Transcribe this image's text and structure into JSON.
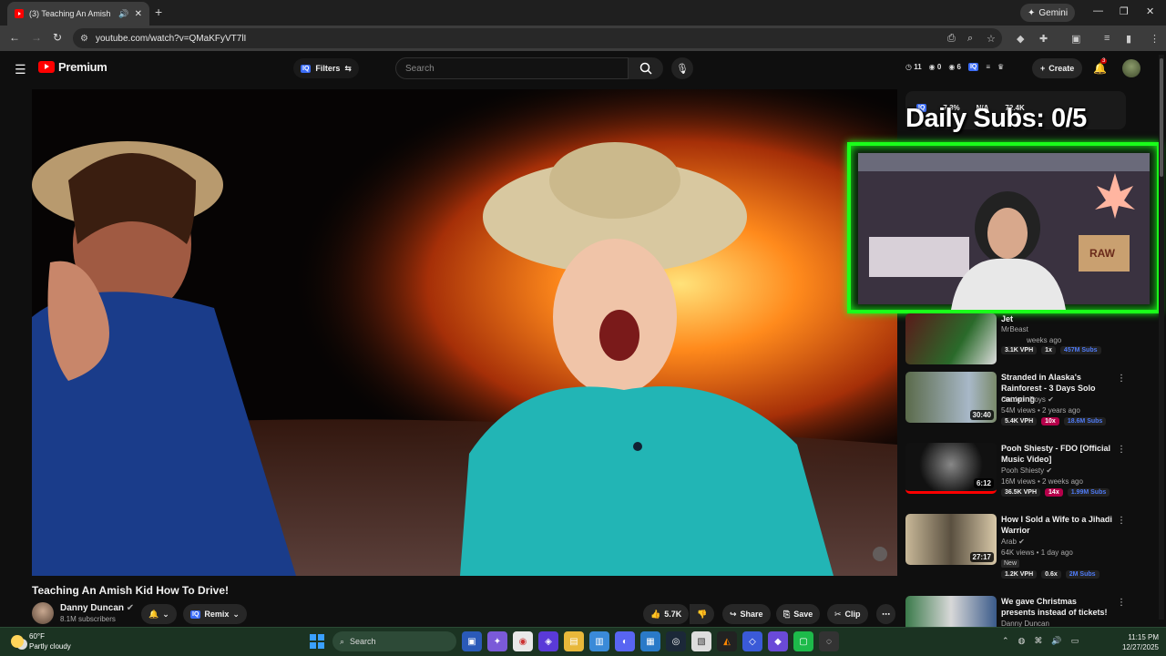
{
  "browser": {
    "tab_title": "(3) Teaching An Amish Kid",
    "url": "youtube.com/watch?v=QMaKFyVT7lI",
    "gemini_label": "Gemini",
    "new_tab": "+"
  },
  "youtube": {
    "logo_text": "Premium",
    "filters_label": "Filters",
    "search_placeholder": "Search",
    "header_stats": {
      "a": "11",
      "b": "0",
      "c": "6"
    },
    "create_label": "Create",
    "notification_count": "3"
  },
  "video": {
    "title": "Teaching An Amish Kid How To Drive!",
    "channel": "Danny Duncan",
    "subscribers": "8.1M subscribers",
    "remix_label": "Remix",
    "likes": "5.7K",
    "share_label": "Share",
    "save_label": "Save",
    "clip_label": "Clip"
  },
  "overlay": {
    "daily_subs": "Daily Subs: 0/5",
    "stat1": "7.3%",
    "stat2": "N/A",
    "stat3": "72.4K"
  },
  "recommendations": [
    {
      "title": "Jet",
      "channel": "MrBeast",
      "meta": "weeks ago",
      "vph": "3.1K VPH",
      "mult": "1x",
      "subs": "457M Subs"
    },
    {
      "title": "Stranded in Alaska's Rainforest - 3 Days Solo camping",
      "channel": "Outdoor Boys",
      "meta": "54M views • 2 years ago",
      "duration": "30:40",
      "vph": "5.4K VPH",
      "mult": "10x",
      "subs": "18.6M Subs"
    },
    {
      "title": "Pooh Shiesty - FDO [Official Music Video]",
      "channel": "Pooh Shiesty",
      "meta": "16M views • 2 weeks ago",
      "duration": "6:12",
      "vph": "36.5K VPH",
      "mult": "14x",
      "subs": "1.99M Subs"
    },
    {
      "title": "How I Sold a Wife to a Jihadi Warrior",
      "channel": "Arab",
      "meta": "64K views • 1 day ago",
      "duration": "27:17",
      "tag": "New",
      "vph": "1.2K VPH",
      "mult": "0.6x",
      "subs": "2M Subs"
    },
    {
      "title": "We gave Christmas presents instead of tickets!",
      "channel": "Danny Duncan"
    }
  ],
  "taskbar": {
    "temp": "60°F",
    "condition": "Partly cloudy",
    "search_label": "Search",
    "time": "11:15 PM",
    "date": "12/27/2025"
  },
  "colors": {
    "accent_green": "#1aff1a",
    "yt_red": "#ff0000",
    "vph_pink": "#b5004a"
  }
}
